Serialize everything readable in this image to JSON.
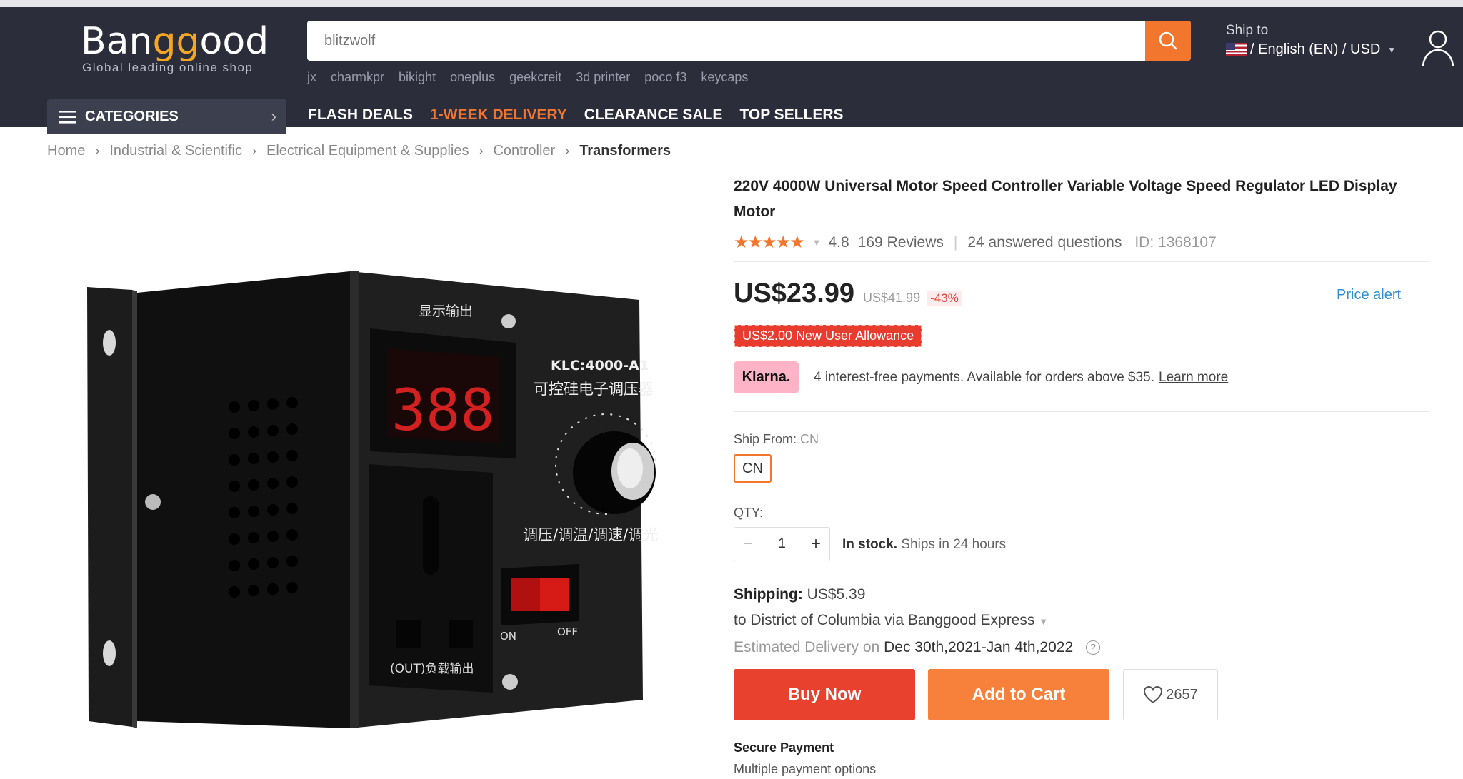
{
  "header": {
    "logo_main": "Ban",
    "logo_gg": "gg",
    "logo_end": "ood",
    "tagline": "Global leading online shop",
    "search_placeholder": "blitzwolf",
    "hot_words": [
      "jx",
      "charmkpr",
      "bikight",
      "oneplus",
      "geekcreit",
      "3d printer",
      "poco f3",
      "keycaps"
    ],
    "ship_to_label": "Ship to",
    "locale": "/ English (EN) / USD"
  },
  "nav": {
    "categories": "CATEGORIES",
    "links": [
      {
        "label": "FLASH DEALS",
        "highlight": false
      },
      {
        "label": "1-WEEK DELIVERY",
        "highlight": true
      },
      {
        "label": "CLEARANCE SALE",
        "highlight": false
      },
      {
        "label": "TOP SELLERS",
        "highlight": false
      }
    ]
  },
  "breadcrumb": [
    "Home",
    "Industrial & Scientific",
    "Electrical Equipment & Supplies",
    "Controller",
    "Transformers"
  ],
  "product": {
    "title": "220V 4000W Universal Motor Speed Controller Variable Voltage Speed Regulator LED Display Motor",
    "stars": "★★★★★",
    "rating": "4.8",
    "reviews": "169 Reviews",
    "questions": "24 answered questions",
    "id": "ID: 1368107",
    "price": "US$23.99",
    "old_price": "US$41.99",
    "discount": "-43%",
    "price_alert": "Price alert",
    "allowance": "US$2.00 New User Allowance",
    "klarna_logo": "Klarna.",
    "klarna_text": "4 interest-free payments. Available for orders above $35.",
    "klarna_link": "Learn more",
    "ship_from_label": "Ship From:",
    "ship_from_value": "CN",
    "ship_from_option": "CN",
    "qty_label": "QTY:",
    "qty": "1",
    "stock_bold": "In stock.",
    "stock_rest": "Ships in 24 hours",
    "shipping_label": "Shipping:",
    "shipping_cost": "US$5.39",
    "shipping_dest": "to District of Columbia via Banggood Express",
    "delivery_label": "Estimated Delivery on",
    "delivery_dates": "Dec 30th,2021-Jan 4th,2022",
    "buy_now": "Buy Now",
    "add_to_cart": "Add to Cart",
    "wishlist_count": "2657",
    "secure_payment": "Secure Payment",
    "payment_options": "Multiple payment options"
  },
  "device_labels": {
    "display_out": "显示输出",
    "model": "KLC:4000-A1",
    "name": "可控硅电子调压器",
    "led": "388",
    "functions": "调压/调温/调速/调光",
    "on": "ON",
    "off": "OFF",
    "output": "(OUT)负载输出"
  },
  "colors": {
    "accent": "#f2762e",
    "header_bg": "#2b2d3b",
    "buy": "#e8412e",
    "cart": "#f7803b",
    "link": "#2e8fd4"
  }
}
